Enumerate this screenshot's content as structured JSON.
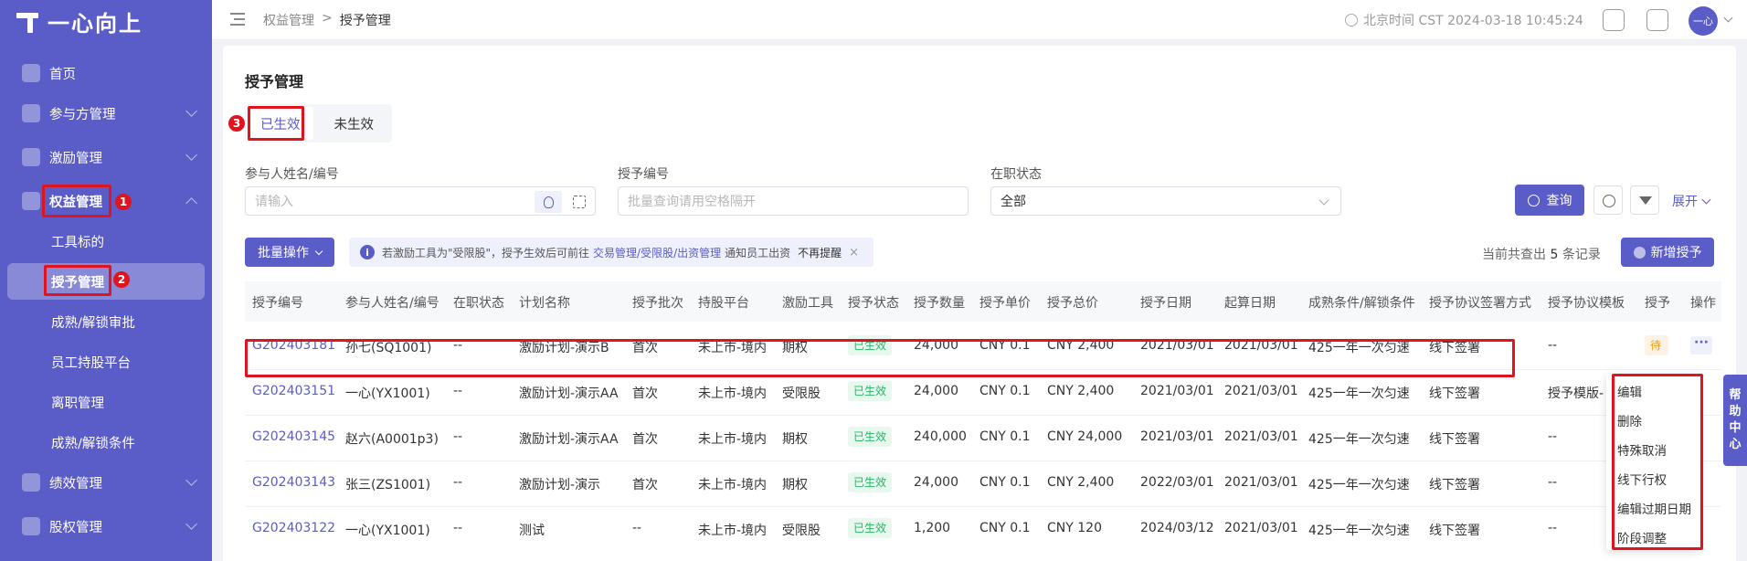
{
  "sidebar": {
    "logo": "一心向上",
    "items": [
      {
        "label": "首页"
      },
      {
        "label": "参与方管理"
      },
      {
        "label": "激励管理"
      },
      {
        "label": "权益管理"
      },
      {
        "label": "绩效管理"
      },
      {
        "label": "股权管理"
      }
    ],
    "sub_items": [
      {
        "label": "工具标的"
      },
      {
        "label": "授予管理"
      },
      {
        "label": "成熟/解锁审批"
      },
      {
        "label": "员工持股平台"
      },
      {
        "label": "离职管理"
      },
      {
        "label": "成熟/解锁条件"
      }
    ]
  },
  "topbar": {
    "breadcrumb_parent": "权益管理",
    "breadcrumb_sep": ">",
    "breadcrumb_current": "授予管理",
    "time": "北京时间 CST 2024-03-18 10:45:24",
    "avatar": "一心"
  },
  "page": {
    "title": "授予管理",
    "tabs": [
      {
        "label": "已生效"
      },
      {
        "label": "未生效"
      }
    ]
  },
  "filters": {
    "participant_label": "参与人姓名/编号",
    "participant_placeholder": "请输入",
    "grant_no_label": "授予编号",
    "grant_no_placeholder": "批量查询请用空格隔开",
    "status_label": "在职状态",
    "status_value": "全部",
    "query_button": "查询",
    "expand": "展开"
  },
  "toolbar": {
    "batch": "批量操作",
    "notice_pre": "若激励工具为\"受限股\"，授予生效后可前往",
    "notice_link": "交易管理/受限股/出资管理",
    "notice_post": "通知员工出资",
    "notice_dismiss": "不再提醒",
    "count_pre": "当前共查出",
    "count": "5",
    "count_post": "条记录",
    "add_button": "新增授予"
  },
  "table": {
    "headers": [
      "授予编号",
      "参与人姓名/编号",
      "在职状态",
      "计划名称",
      "授予批次",
      "持股平台",
      "激励工具",
      "授予状态",
      "授予数量",
      "授予单价",
      "授予总价",
      "授予日期",
      "起算日期",
      "成熟条件/解锁条件",
      "授予协议签署方式",
      "授予协议模板",
      "授予",
      "操作"
    ],
    "rows": [
      {
        "id": "G202403181",
        "person": "孙七(SQ1001)",
        "emp": "--",
        "plan": "激励计划-演示B",
        "batch": "首次",
        "platform": "未上市-境内",
        "tool": "期权",
        "status": "已生效",
        "qty": "24,000",
        "price": "CNY  0.1",
        "total": "CNY  2,400",
        "grant_date": "2021/03/01",
        "start_date": "2021/03/01",
        "condition": "425一年一次匀速",
        "sign": "线下签署",
        "template": "--",
        "extra": "待上"
      },
      {
        "id": "G202403151",
        "person": "一心(YX1001)",
        "emp": "--",
        "plan": "激励计划-演示AA",
        "batch": "首次",
        "platform": "未上市-境内",
        "tool": "受限股",
        "status": "已生效",
        "qty": "24,000",
        "price": "CNY  0.1",
        "total": "CNY  2,400",
        "grant_date": "2021/03/01",
        "start_date": "2021/03/01",
        "condition": "425一年一次匀速",
        "sign": "线下签署",
        "template": "授予模版-"
      },
      {
        "id": "G202403145",
        "person": "赵六(A0001p3)",
        "emp": "--",
        "plan": "激励计划-演示AA",
        "batch": "首次",
        "platform": "未上市-境内",
        "tool": "期权",
        "status": "已生效",
        "qty": "240,000",
        "price": "CNY  0.1",
        "total": "CNY  24,000",
        "grant_date": "2021/03/01",
        "start_date": "2021/03/01",
        "condition": "425一年一次匀速",
        "sign": "线下签署",
        "template": "--"
      },
      {
        "id": "G202403143",
        "person": "张三(ZS1001)",
        "emp": "--",
        "plan": "激励计划-演示",
        "batch": "首次",
        "platform": "未上市-境内",
        "tool": "期权",
        "status": "已生效",
        "qty": "24,000",
        "price": "CNY  0.1",
        "total": "CNY  2,400",
        "grant_date": "2022/03/01",
        "start_date": "2021/03/01",
        "condition": "425一年一次匀速",
        "sign": "线下签署",
        "template": "--"
      },
      {
        "id": "G202403122",
        "person": "一心(YX1001)",
        "emp": "--",
        "plan": "测试",
        "batch": "--",
        "platform": "未上市-境内",
        "tool": "受限股",
        "status": "已生效",
        "qty": "1,200",
        "price": "CNY  0.1",
        "total": "CNY  120",
        "grant_date": "2024/03/12",
        "start_date": "2021/03/01",
        "condition": "425一年一次匀速",
        "sign": "线下签署",
        "template": "--"
      }
    ]
  },
  "row_menu": [
    "编辑",
    "删除",
    "特殊取消",
    "线下行权",
    "编辑过期日期",
    "阶段调整"
  ],
  "help": [
    "帮",
    "助",
    "中",
    "心"
  ],
  "annotations": [
    "1",
    "2",
    "3"
  ]
}
